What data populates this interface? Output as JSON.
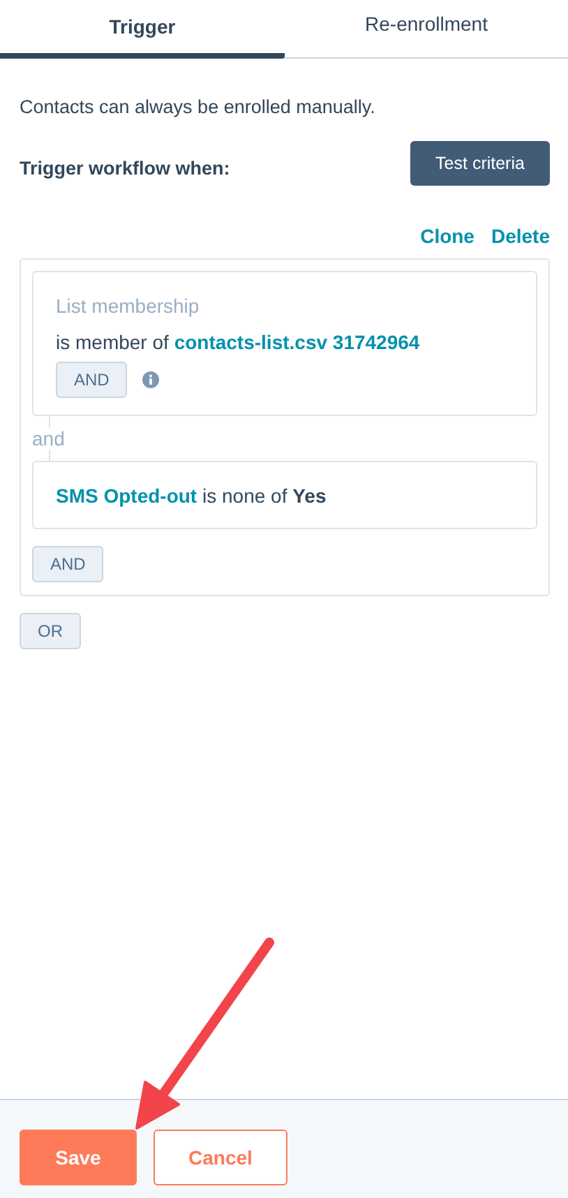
{
  "tabs": [
    {
      "label": "Trigger",
      "selected": true
    },
    {
      "label": "Re-enrollment",
      "selected": false
    }
  ],
  "note": "Contacts can always be enrolled manually.",
  "trigger_label": "Trigger workflow when:",
  "test_button": "Test criteria",
  "group_actions": [
    "Clone",
    "Delete"
  ],
  "group": {
    "filters": [
      {
        "kind": "list",
        "label": "List membership",
        "operator": "is member of",
        "value": "contacts-list.csv 31742964",
        "and_button": "AND",
        "info": true
      },
      {
        "kind": "property",
        "property": "SMS Opted-out",
        "operator": "is none of",
        "value": "Yes"
      }
    ],
    "joiner": "and",
    "and_button": "AND"
  },
  "or_button": "OR",
  "footer": {
    "buttons": [
      {
        "label": "Save",
        "kind": "primary"
      },
      {
        "label": "Cancel",
        "kind": "secondary"
      }
    ]
  },
  "annotation": {
    "kind": "arrow"
  }
}
